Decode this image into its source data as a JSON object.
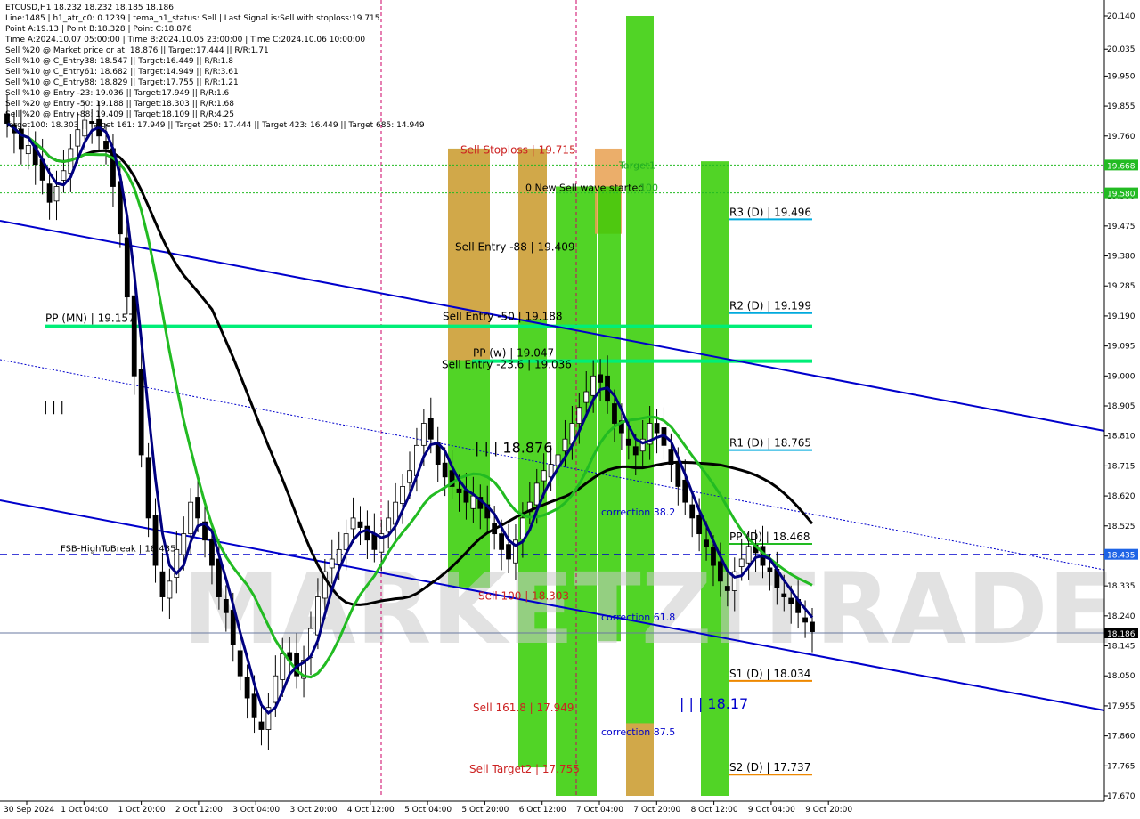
{
  "header_lines": [
    "ETCUSD,H1  18.232 18.232 18.185 18.186",
    "Line:1485  |  h1_atr_c0: 0.1239  |  tema_h1_status: Sell  |  Last Signal is:Sell with stoploss:19.715",
    "Point A:19.13  |  Point B:18.328  |  Point C:18.876",
    "Time A:2024.10.07 05:00:00  |  Time B:2024.10.05 23:00:00  |  Time C:2024.10.06 10:00:00",
    "Sell %20 @ Market price or at: 18.876  ||  Target:17.444  ||  R/R:1.71",
    "Sell %10 @ C_Entry38: 18.547  ||  Target:16.449  ||  R/R:1.8",
    "Sell %10 @ C_Entry61: 18.682  ||  Target:14.949  ||  R/R:3.61",
    "Sell %10 @ C_Entry88: 18.829  ||  Target:17.755  ||  R/R:1.21",
    "Sell %10 @ Entry -23: 19.036  ||  Target:17.949  ||  R/R:1.6",
    "Sell %20 @ Entry -50: 19.188  ||  Target:18.303  ||  R/R:1.68",
    "Sell %20 @ Entry -88: 19.409  ||  Target:18.109  ||  R/R:4.25",
    "Target100: 18.303  ||  Target 161: 17.949  ||  Target 250: 17.444  ||  Target 423: 16.449  ||  Target 685: 14.949"
  ],
  "watermark": "MARKETZITRADE",
  "colors": {
    "green_zone": "#33cc00",
    "orange_zone": "#e8a050",
    "pivot_green": "#00ee77",
    "channel": "#0000cc",
    "ma_black": "#000000",
    "ma_green": "#22bb22",
    "ma_navy": "#000080",
    "price_tag_bg": "#1e64e6",
    "current_tag_bg": "#000000",
    "level_tag_green": "#22bb22"
  },
  "chart_data": {
    "type": "candlestick",
    "symbol": "ETCUSD",
    "timeframe": "H1",
    "ylim": [
      17.67,
      20.14
    ],
    "x_tick_labels": [
      "30 Sep 2024",
      "1 Oct 04:00",
      "1 Oct 20:00",
      "2 Oct 12:00",
      "3 Oct 04:00",
      "3 Oct 20:00",
      "4 Oct 12:00",
      "5 Oct 04:00",
      "5 Oct 20:00",
      "6 Oct 12:00",
      "7 Oct 04:00",
      "7 Oct 20:00",
      "8 Oct 12:00",
      "9 Oct 04:00",
      "9 Oct 20:00"
    ],
    "y_tick_labels": [
      20.14,
      20.035,
      19.95,
      19.855,
      19.76,
      19.665,
      19.57,
      19.475,
      19.38,
      19.285,
      19.19,
      19.095,
      19.0,
      18.905,
      18.81,
      18.715,
      18.62,
      18.525,
      18.43,
      18.335,
      18.24,
      18.145,
      18.05,
      17.955,
      17.86,
      17.765,
      17.67
    ],
    "y_axis_tags": [
      {
        "text": "19.668",
        "value": 19.668,
        "style": "green"
      },
      {
        "text": "19.580",
        "value": 19.58,
        "style": "green"
      },
      {
        "text": "18.435",
        "value": 18.435,
        "style": "blue"
      },
      {
        "text": "18.186",
        "value": 18.186,
        "style": "black"
      }
    ],
    "levels": [
      {
        "label": "R3 (D) | 19.496",
        "value": 19.496
      },
      {
        "label": "R2 (D) | 19.199",
        "value": 19.199
      },
      {
        "label": "R1 (D) | 18.765",
        "value": 18.765
      },
      {
        "label": "PP (D) | 18.468",
        "value": 18.468
      },
      {
        "label": "S1 (D) | 18.034",
        "value": 18.034
      },
      {
        "label": "S2 (D) | 17.737",
        "value": 17.737
      }
    ],
    "pivots": [
      {
        "label": "PP (MN) | 19.157",
        "value": 19.157
      },
      {
        "label": "PP (w) | 19.047",
        "value": 19.047
      }
    ],
    "fsb_label": "FSB-HighToBreak | 18.435",
    "fsb_value": 18.435,
    "annotations": [
      "Sell Stoploss | 19.715",
      "Target1",
      "0 New Sell wave started",
      "100",
      "Sell Entry -88 | 19.409",
      "| | | 18.876",
      "Sell Entry -50 | 19.188",
      "Sell Entry -23.6 | 19.036",
      "Sell 100 | 18.303",
      "Sell 161.8 | 17.949",
      "Sell Target2 | 17.755",
      "correction 38.2",
      "correction 61.8",
      "correction 87.5",
      "| | | 18.17",
      "| | |"
    ],
    "ohlc_last": {
      "open": 18.232,
      "high": 18.232,
      "low": 18.185,
      "close": 18.186
    },
    "closes": [
      19.8,
      19.77,
      19.72,
      19.73,
      19.67,
      19.62,
      19.55,
      19.6,
      19.65,
      19.72,
      19.78,
      19.81,
      19.8,
      19.76,
      19.72,
      19.6,
      19.45,
      19.25,
      19.0,
      18.75,
      18.55,
      18.4,
      18.3,
      18.35,
      18.45,
      18.5,
      18.6,
      18.55,
      18.48,
      18.4,
      18.3,
      18.25,
      18.15,
      18.05,
      17.98,
      17.92,
      17.88,
      17.95,
      18.05,
      18.12,
      18.1,
      18.05,
      18.1,
      18.2,
      18.3,
      18.38,
      18.42,
      18.45,
      18.5,
      18.55,
      18.52,
      18.48,
      18.45,
      18.5,
      18.55,
      18.6,
      18.65,
      18.7,
      18.78,
      18.85,
      18.8,
      18.72,
      18.68,
      18.65,
      18.63,
      18.6,
      18.62,
      18.58,
      18.55,
      18.5,
      18.45,
      18.42,
      18.48,
      18.55,
      18.6,
      18.66,
      18.7,
      18.72,
      18.75,
      18.8,
      18.85,
      18.9,
      18.95,
      19.0,
      18.98,
      18.92,
      18.85,
      18.82,
      18.78,
      18.75,
      18.8,
      18.85,
      18.82,
      18.78,
      18.72,
      18.65,
      18.6,
      18.55,
      18.5,
      18.46,
      18.4,
      18.35,
      18.32,
      18.38,
      18.42,
      18.46,
      18.44,
      18.4,
      18.38,
      18.33,
      18.3,
      18.28,
      18.25,
      18.22,
      18.19
    ]
  }
}
